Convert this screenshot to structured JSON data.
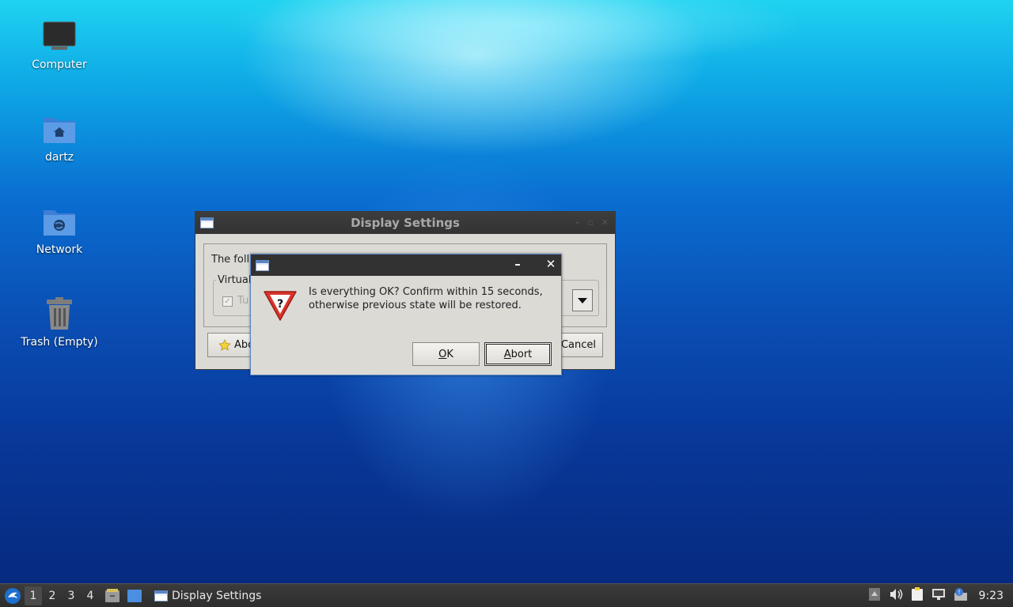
{
  "desktop": {
    "icons": [
      {
        "label": "Computer",
        "icon": "computer-icon"
      },
      {
        "label": "dartz",
        "icon": "home-folder-icon"
      },
      {
        "label": "Network",
        "icon": "network-folder-icon"
      },
      {
        "label": "Trash (Empty)",
        "icon": "trash-icon"
      }
    ]
  },
  "back_window": {
    "title": "Display Settings",
    "text_partial": "The foll",
    "group_label_partial": "Virtual",
    "checkbox_label_partial": "Tu",
    "about_label_partial": "Abo",
    "cancel_label_partial": "Cancel"
  },
  "dialog": {
    "message_line1": "Is everything OK? Confirm within 15 seconds,",
    "message_line2": "otherwise previous state will be restored.",
    "minimize_glyph": "–",
    "close_glyph": "✕",
    "ok_label_accel": "O",
    "ok_label_rest": "K",
    "abort_label_accel": "A",
    "abort_label_rest": "bort"
  },
  "taskbar": {
    "workspaces": [
      "1",
      "2",
      "3",
      "4"
    ],
    "active_workspace": "1",
    "task_label": "Display Settings",
    "clock": "9:23"
  },
  "colors": {
    "titlebar": "#323232",
    "dialog_border": "#5a87c6",
    "window_bg": "#dcdad5",
    "warning_red": "#d8342b"
  }
}
